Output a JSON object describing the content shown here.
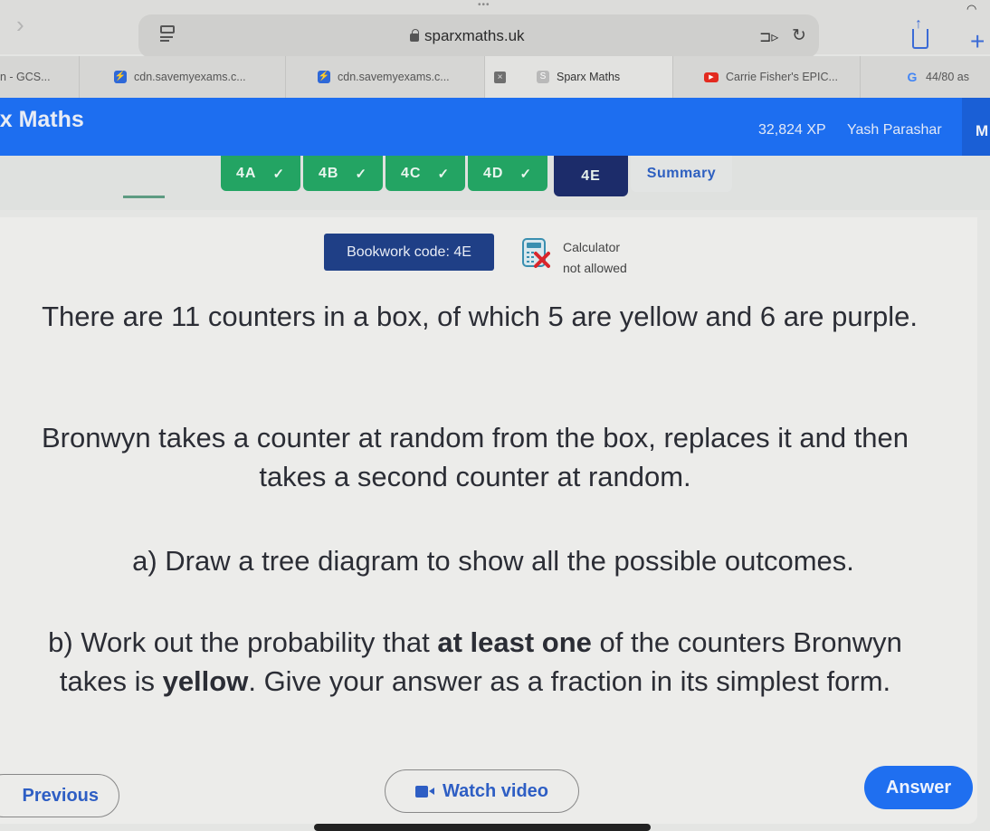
{
  "browser": {
    "url": "sparxmaths.uk",
    "tabs": [
      {
        "label": "n - GCS...",
        "favicon": "none",
        "active": false
      },
      {
        "label": "cdn.savemyexams.c...",
        "favicon": "lightning-icon",
        "active": false
      },
      {
        "label": "cdn.savemyexams.c...",
        "favicon": "lightning-icon",
        "active": false
      },
      {
        "label": "Sparx Maths",
        "favicon": "sparx-icon",
        "active": true
      },
      {
        "label": "Carrie Fisher's EPIC...",
        "favicon": "youtube-icon",
        "active": false
      },
      {
        "label": "44/80 as",
        "favicon": "google-icon",
        "active": false
      }
    ],
    "favicon_glyphs": {
      "lightning": "⚡",
      "sparx": "S",
      "youtube": "▶",
      "google": "G"
    },
    "close_glyph": "×",
    "plus_glyph": "+",
    "back_glyph": "›",
    "reload_glyph": "↻"
  },
  "header": {
    "brand": "rx Maths",
    "xp": "32,824 XP",
    "username": "Yash Parashar",
    "menu_initial": "M"
  },
  "task_tabs": [
    {
      "label": "4A",
      "complete": true,
      "check": "✓"
    },
    {
      "label": "4B",
      "complete": true,
      "check": "✓"
    },
    {
      "label": "4C",
      "complete": true,
      "check": "✓"
    },
    {
      "label": "4D",
      "complete": true,
      "check": "✓"
    },
    {
      "label": "4E",
      "complete": false,
      "current": true
    },
    {
      "label": "Summary",
      "complete": false
    }
  ],
  "question": {
    "bookwork_code": "Bookwork code: 4E",
    "calculator_line1": "Calculator",
    "calculator_line2": "not allowed",
    "para1": "There are 11 counters in a box, of which 5 are yellow and 6 are purple.",
    "para2": "Bronwyn takes a counter at random from the box, replaces it and then takes a second counter at random.",
    "part_a": "a) Draw a tree diagram to show all the possible outcomes.",
    "part_b_pre": "b) Work out the probability that ",
    "part_b_bold1": "at least one",
    "part_b_mid": " of the counters Bronwyn takes is ",
    "part_b_bold2": "yellow",
    "part_b_post": ". Give your answer as a fraction in its simplest form."
  },
  "buttons": {
    "previous": "Previous",
    "watch_video": "Watch video",
    "answer": "Answer"
  },
  "colors": {
    "header_blue": "#1d6ef0",
    "tab_complete_green": "#23a463",
    "tab_current_navy": "#1c2c6a",
    "bookwork_navy": "#1f3f86",
    "answer_blue": "#1f6ff0",
    "link_blue": "#2e5ec4"
  }
}
